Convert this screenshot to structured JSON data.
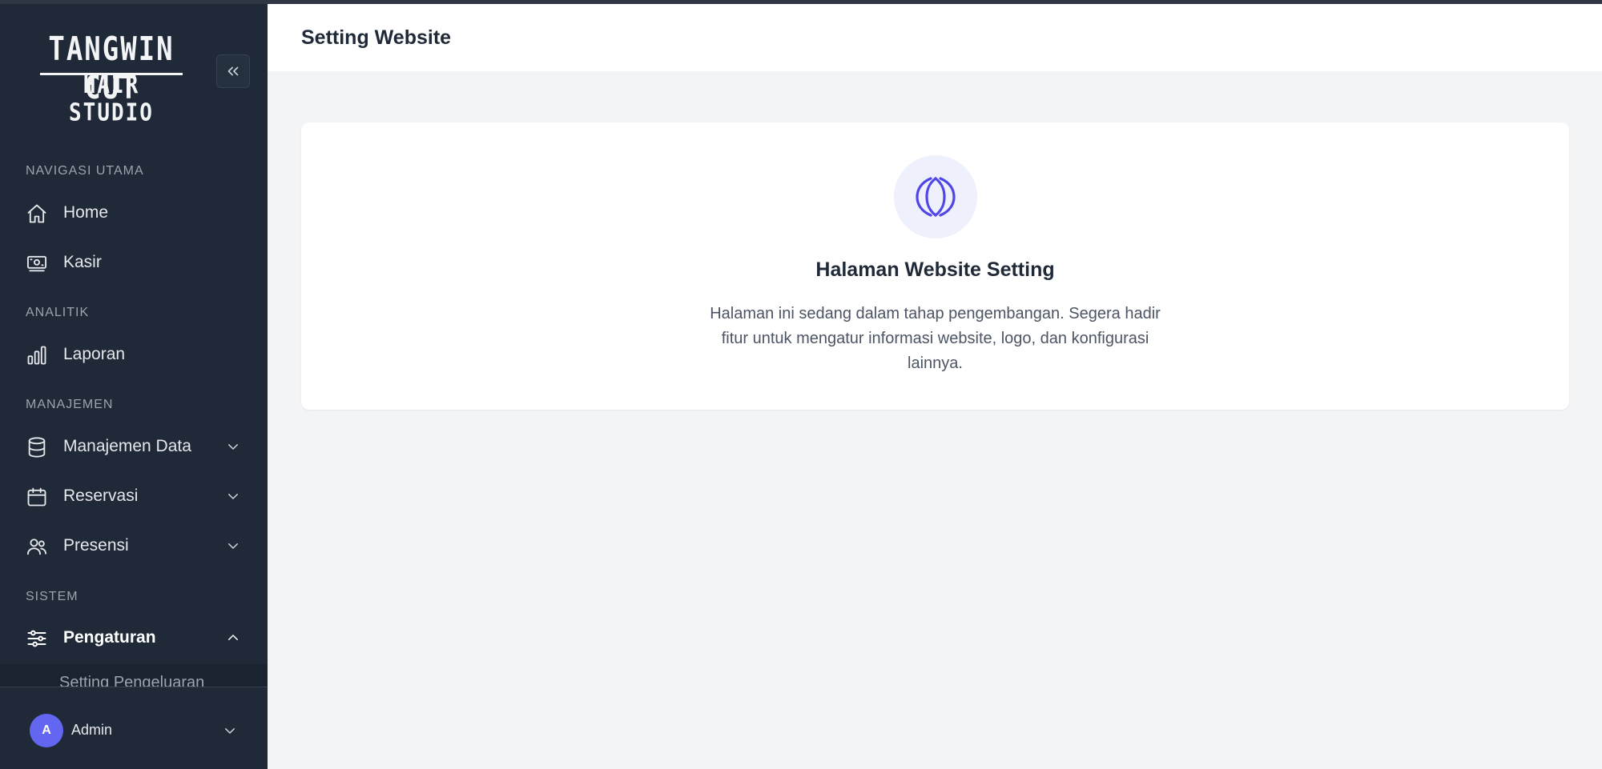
{
  "brand": {
    "line1": "TANGWIN CUT",
    "line2": "HAIR STUDIO"
  },
  "sidebar": {
    "sections": {
      "main": "NAVIGASI UTAMA",
      "analytics": "ANALITIK",
      "management": "MANAJEMEN",
      "system": "SISTEM"
    },
    "items": {
      "home": {
        "label": "Home",
        "icon": "home-icon"
      },
      "cashier": {
        "label": "Kasir",
        "icon": "cash-icon"
      },
      "report": {
        "label": "Laporan",
        "icon": "bar-chart-icon"
      },
      "data": {
        "label": "Manajemen Data",
        "icon": "database-icon"
      },
      "reservation": {
        "label": "Reservasi",
        "icon": "calendar-icon"
      },
      "attendance": {
        "label": "Presensi",
        "icon": "users-icon"
      },
      "settings": {
        "label": "Pengaturan",
        "icon": "sliders-icon",
        "active": true
      }
    },
    "submenu_partial": "Setting Pengeluaran",
    "user": {
      "initial": "A",
      "name": "Admin"
    }
  },
  "header": {
    "title": "Setting Website"
  },
  "card": {
    "icon": "globe-icon",
    "title": "Halaman Website Setting",
    "description": "Halaman ini sedang dalam tahap pengembangan. Segera hadir fitur untuk mengatur informasi website, logo, dan konfigurasi lainnya."
  },
  "colors": {
    "sidebar_bg": "#1f2937",
    "accent": "#4f46e5",
    "avatar": "#6366f1",
    "page_bg": "#f3f4f6"
  }
}
